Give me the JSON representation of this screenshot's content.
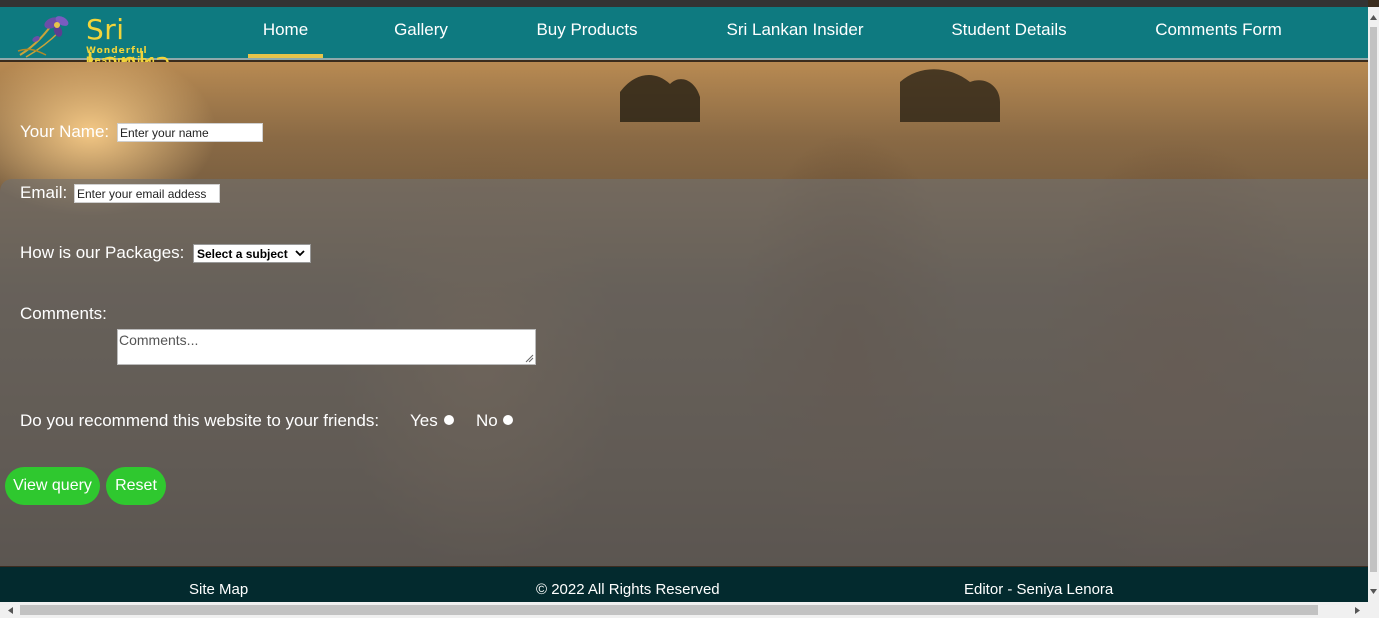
{
  "brand": {
    "title": "Sri Lanka",
    "subtitle": "Wonderful Destination",
    "accent_color": "#f2d43a",
    "logo_icon": "orchid-flower-icon"
  },
  "nav": {
    "background_color": "#0e7a80",
    "active_underline_color": "#e6c44a",
    "items": [
      {
        "label": "Home",
        "active": true
      },
      {
        "label": "Gallery",
        "active": false
      },
      {
        "label": "Buy Products",
        "active": false
      },
      {
        "label": "Sri Lankan Insider",
        "active": false
      },
      {
        "label": "Student Details",
        "active": false
      },
      {
        "label": "Comments Form",
        "active": false
      }
    ]
  },
  "form": {
    "name_label": "Your Name:",
    "name_placeholder": "Enter your name",
    "email_label": "Email:",
    "email_placeholder": "Enter your email addess",
    "packages_label": "How is our Packages:",
    "packages_selected": "Select a subject",
    "comments_label": "Comments:",
    "comments_placeholder": "Comments...",
    "recommend_label": "Do you recommend this website to your friends:",
    "yes_label": "Yes",
    "no_label": "No",
    "view_button": "View query",
    "reset_button": "Reset",
    "button_color": "#2fc82f"
  },
  "footer": {
    "background_color": "#032a2e",
    "site_map": "Site Map",
    "copyright": "© 2022 All Rights Reserved",
    "editor": "Editor - Seniya Lenora"
  }
}
